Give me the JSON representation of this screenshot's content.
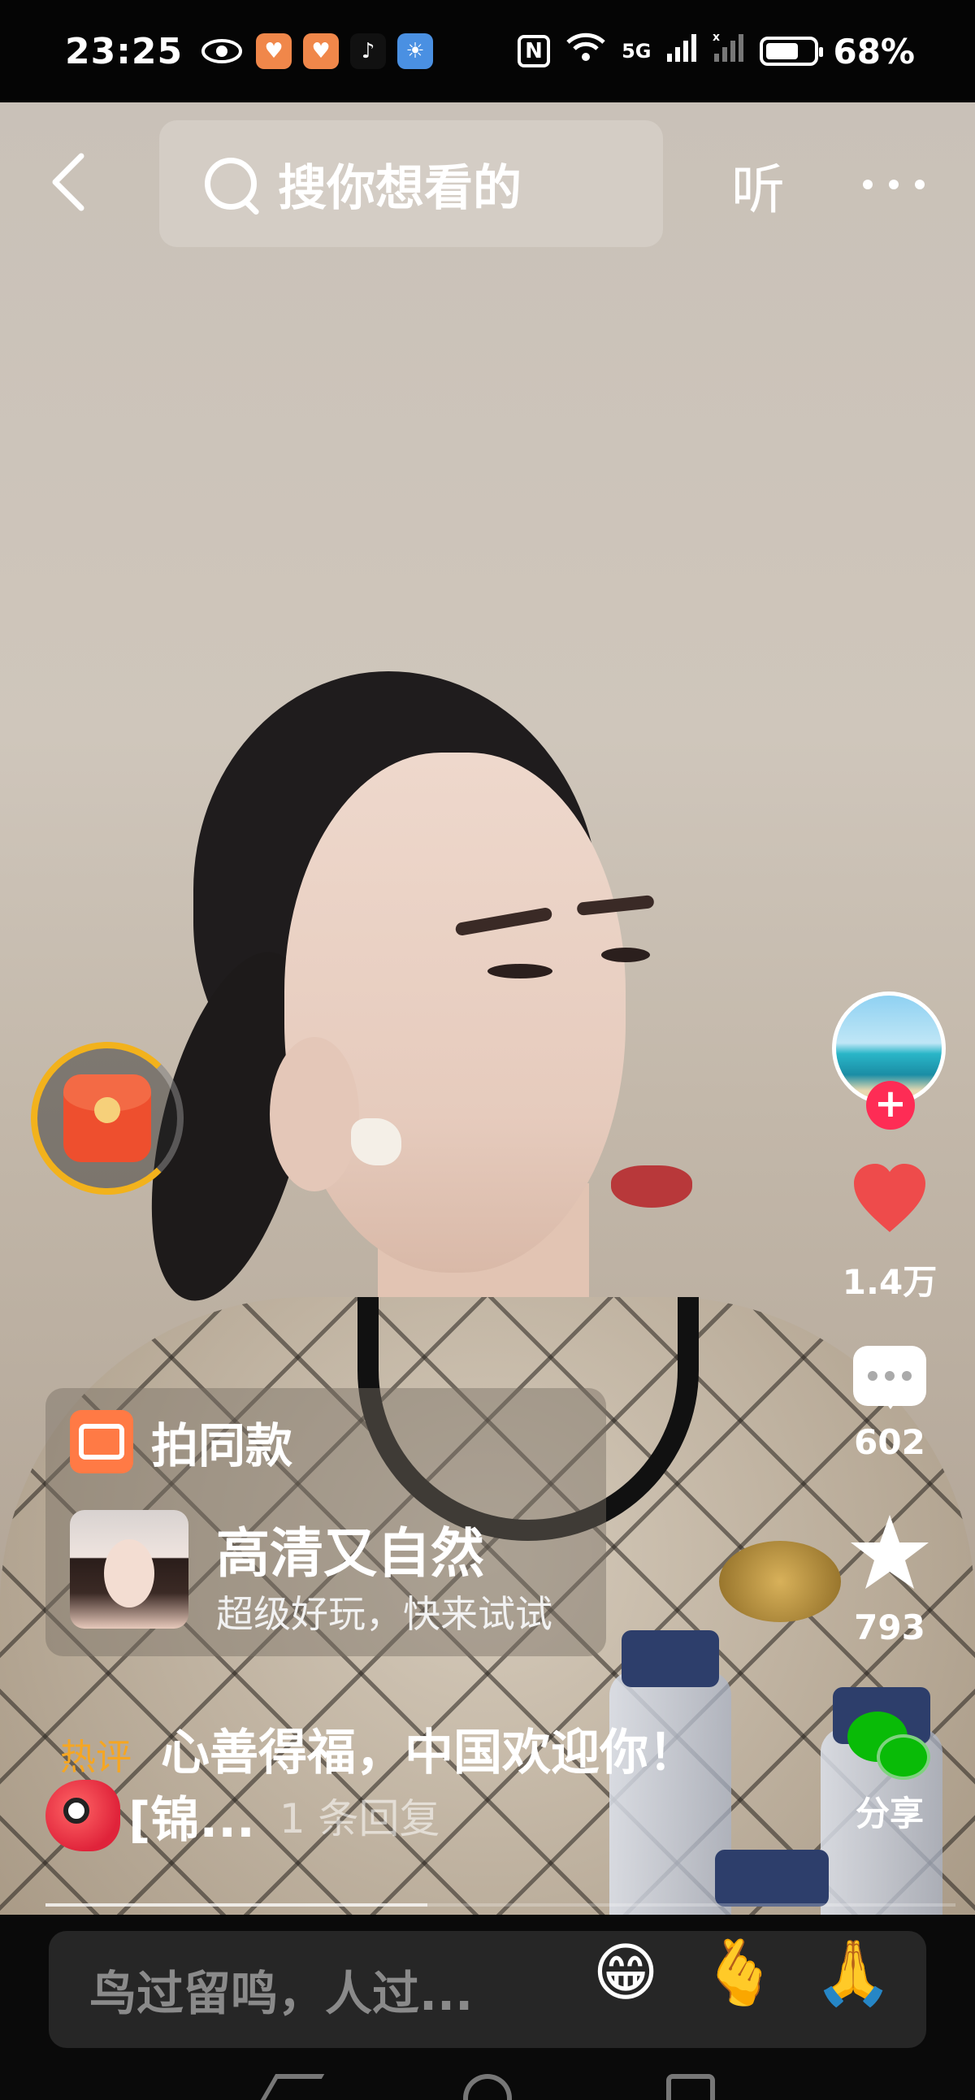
{
  "status_bar": {
    "time": "23:25",
    "network": "5G",
    "battery_percent": "68%",
    "battery_level": 0.68,
    "icons": [
      "eye-icon",
      "app-icon",
      "app-icon",
      "tiktok-icon",
      "weather-icon",
      "nfc-icon",
      "wifi-icon",
      "signal-icon",
      "signal-off-icon",
      "battery-icon"
    ]
  },
  "top_bar": {
    "back_icon": "chevron-left-icon",
    "search_placeholder": "搜你想看的",
    "listen_label": "听",
    "more_icon": "more-icon"
  },
  "actions": {
    "like_count": "1.4万",
    "comment_count": "602",
    "favorite_count": "793",
    "share_label": "分享"
  },
  "template_card": {
    "title": "拍同款",
    "name": "高清又自然",
    "description": "超级好玩，快来试试"
  },
  "hot_comment": {
    "tag": "热评",
    "text": "心善得福，中国欢迎你！",
    "reply_prefix": "[锦...",
    "reply_count": "1 条回复"
  },
  "playback": {
    "progress": 0.42
  },
  "comment_bar": {
    "placeholder": "鸟过留鸣，人过...",
    "emojis": [
      "😁",
      "🫰",
      "🙏"
    ]
  },
  "colors": {
    "accent_red": "#fe2c55",
    "hot_tag": "#f5a623",
    "wechat_green": "#09bb07"
  }
}
